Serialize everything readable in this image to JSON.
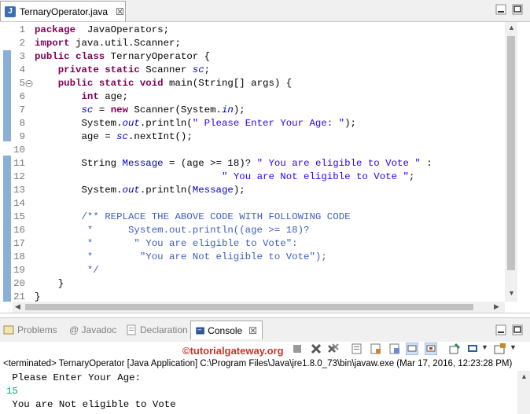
{
  "editor_tab": {
    "title": "TernaryOperator.java",
    "close": "☒",
    "icon": "java-file-icon"
  },
  "window": {
    "minimize": "minimize-icon",
    "maximize": "maximize-icon"
  },
  "code_lines": [
    {
      "n": "1",
      "segs": [
        [
          "kw",
          "package"
        ],
        [
          "",
          "  JavaOperators;"
        ]
      ]
    },
    {
      "n": "2",
      "segs": [
        [
          "kw",
          "import"
        ],
        [
          "",
          " java.util.Scanner;"
        ]
      ]
    },
    {
      "n": "3",
      "segs": [
        [
          "kw",
          "public"
        ],
        [
          "",
          " "
        ],
        [
          "kw",
          "class"
        ],
        [
          "",
          " TernaryOperator {"
        ]
      ]
    },
    {
      "n": "4",
      "segs": [
        [
          "",
          "    "
        ],
        [
          "kw",
          "private"
        ],
        [
          "",
          " "
        ],
        [
          "kw",
          "static"
        ],
        [
          "",
          " Scanner "
        ],
        [
          "fld",
          "sc"
        ],
        [
          "",
          ";"
        ]
      ]
    },
    {
      "n": "5",
      "segs": [
        [
          "",
          "    "
        ],
        [
          "kw",
          "public"
        ],
        [
          "",
          " "
        ],
        [
          "kw",
          "static"
        ],
        [
          "",
          " "
        ],
        [
          "kw",
          "void"
        ],
        [
          "",
          " main(String[] args) {"
        ]
      ]
    },
    {
      "n": "6",
      "segs": [
        [
          "",
          "        "
        ],
        [
          "kw",
          "int"
        ],
        [
          "",
          " age;"
        ]
      ]
    },
    {
      "n": "7",
      "segs": [
        [
          "",
          "        "
        ],
        [
          "fld",
          "sc"
        ],
        [
          "",
          " = "
        ],
        [
          "kw",
          "new"
        ],
        [
          "",
          " Scanner(System."
        ],
        [
          "fld",
          "in"
        ],
        [
          "",
          ");"
        ]
      ]
    },
    {
      "n": "8",
      "segs": [
        [
          "",
          "        System."
        ],
        [
          "fld",
          "out"
        ],
        [
          "",
          ".println("
        ],
        [
          "str",
          "\" Please Enter Your Age: \""
        ],
        [
          "",
          ");"
        ]
      ]
    },
    {
      "n": "9",
      "segs": [
        [
          "",
          "        age = "
        ],
        [
          "fld",
          "sc"
        ],
        [
          "",
          ".nextInt();"
        ]
      ]
    },
    {
      "n": "10",
      "segs": []
    },
    {
      "n": "11",
      "segs": [
        [
          "",
          "        String "
        ],
        [
          "fldn",
          "Message"
        ],
        [
          "",
          " = (age >= 18)? "
        ],
        [
          "str",
          "\" You are eligible to Vote \""
        ],
        [
          "",
          " :"
        ]
      ]
    },
    {
      "n": "12",
      "segs": [
        [
          "",
          "                                "
        ],
        [
          "str",
          "\" You are Not eligible to Vote \""
        ],
        [
          "",
          ";"
        ]
      ]
    },
    {
      "n": "13",
      "segs": [
        [
          "",
          "        System."
        ],
        [
          "fld",
          "out"
        ],
        [
          "",
          ".println("
        ],
        [
          "fldn",
          "Message"
        ],
        [
          "",
          ");"
        ]
      ]
    },
    {
      "n": "14",
      "segs": []
    },
    {
      "n": "15",
      "segs": [
        [
          "",
          "        "
        ],
        [
          "cm",
          "/** REPLACE THE ABOVE CODE WITH FOLLOWING CODE"
        ]
      ]
    },
    {
      "n": "16",
      "segs": [
        [
          "",
          "         "
        ],
        [
          "cm",
          "*      System.out.println((age >= 18)?"
        ]
      ]
    },
    {
      "n": "17",
      "segs": [
        [
          "",
          "         "
        ],
        [
          "cm",
          "*       \" You are eligible to Vote\":"
        ]
      ]
    },
    {
      "n": "18",
      "segs": [
        [
          "",
          "         "
        ],
        [
          "cm",
          "*        \"You are Not eligible to Vote\");"
        ]
      ]
    },
    {
      "n": "19",
      "segs": [
        [
          "",
          "         "
        ],
        [
          "cm",
          "*/"
        ]
      ]
    },
    {
      "n": "20",
      "segs": [
        [
          "",
          "    }"
        ]
      ]
    },
    {
      "n": "21",
      "segs": [
        [
          "",
          "}"
        ]
      ]
    }
  ],
  "view_tabs": [
    {
      "label": "Problems",
      "icon": "problems-icon"
    },
    {
      "label": "@ Javadoc",
      "icon": "javadoc-icon"
    },
    {
      "label": "Declaration",
      "icon": "declaration-icon"
    },
    {
      "label": "Console",
      "icon": "console-icon",
      "active": true,
      "close": "☒"
    }
  ],
  "watermark": "©tutorialgateway.org",
  "console": {
    "status": "<terminated> TernaryOperator [Java Application] C:\\Program Files\\Java\\jre1.8.0_73\\bin\\javaw.exe (Mar 17, 2016, 12:23:28 PM)",
    "lines": [
      {
        "text": " Please Enter Your Age:",
        "color": "#000000"
      },
      {
        "text": "15",
        "color": "#00a86b"
      },
      {
        "text": " You are Not eligible to Vote",
        "color": "#000000"
      }
    ]
  },
  "colors": {
    "accent": "#3b6fb5",
    "keyword": "#7f0055",
    "string": "#2a00ff",
    "field": "#0000c0",
    "comment": "#3f5fbf"
  }
}
